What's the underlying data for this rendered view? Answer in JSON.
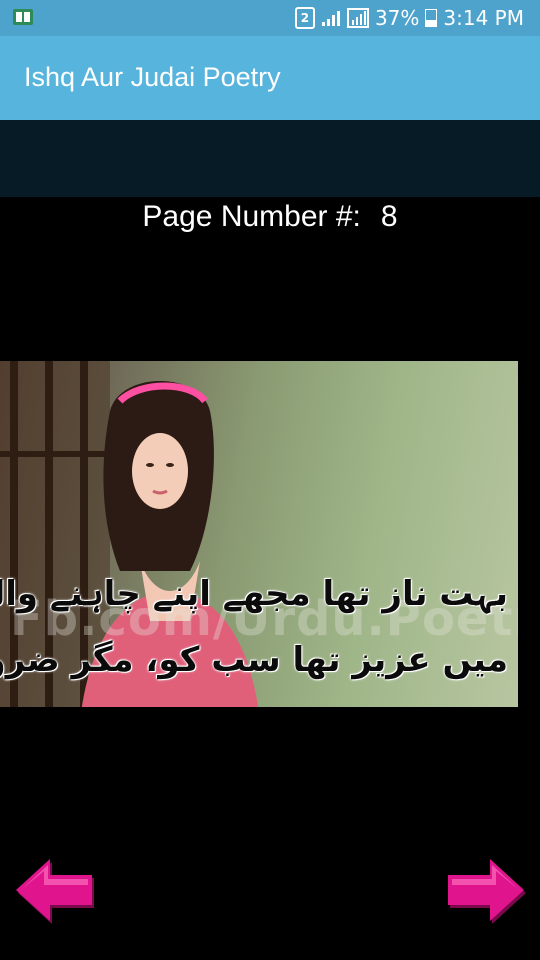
{
  "status_bar": {
    "sim_slot": "2",
    "battery_percent": "37%",
    "time": "3:14 PM"
  },
  "app_bar": {
    "title": "Ishq Aur Judai Poetry"
  },
  "page": {
    "label": "Page Number #:",
    "number": "8"
  },
  "poetry_image": {
    "line_1": "بہت ناز تھا مجھے اپنے چاہنے والوں پر",
    "line_2": "میں عزیز تھا سب کو، مگر ضرورتوں کے لئے",
    "watermark": "Fb.com/Urdu.Poetry"
  },
  "navigation": {
    "prev_icon": "arrow-left-icon",
    "next_icon": "arrow-right-icon",
    "arrow_color": "#e0158d"
  }
}
